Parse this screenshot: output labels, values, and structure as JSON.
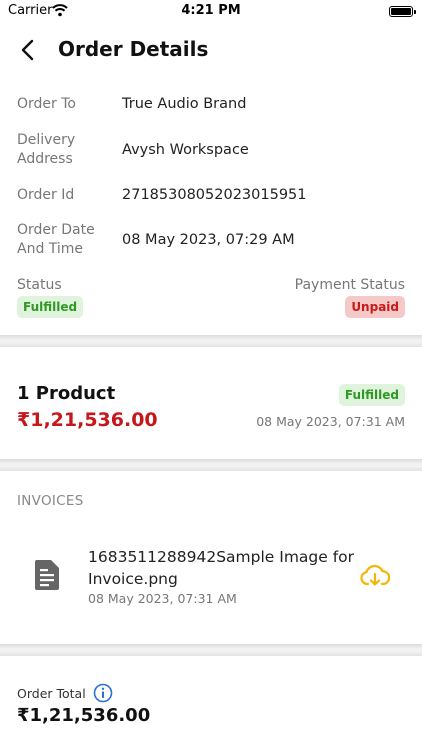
{
  "status_bar": {
    "carrier": "Carrier",
    "time": "4:21 PM"
  },
  "header": {
    "title": "Order Details",
    "back_icon": "chevron-left-icon"
  },
  "details": {
    "order_to_label": "Order To",
    "order_to_value": "True Audio Brand",
    "delivery_label": "Delivery Address",
    "delivery_value": "Avysh Workspace",
    "order_id_label": "Order Id",
    "order_id_value": "27185308052023015951",
    "order_date_label": "Order Date And Time",
    "order_date_value": "08 May 2023, 07:29 AM",
    "status_label": "Status",
    "status_value": "Fulfilled",
    "payment_status_label": "Payment Status",
    "payment_status_value": "Unpaid"
  },
  "product": {
    "count_label": "1 Product",
    "amount": "₹1,21,536.00",
    "status": "Fulfilled",
    "date": "08 May 2023, 07:31 AM"
  },
  "invoices": {
    "heading": "INVOICES",
    "items": [
      {
        "name": "1683511288942Sample Image for Invoice.png",
        "date": "08 May 2023, 07:31 AM",
        "file_icon": "file-document-icon",
        "download_icon": "cloud-download-icon"
      }
    ]
  },
  "footer": {
    "order_total_label": "Order Total",
    "order_total_value": "₹1,21,536.00",
    "info_icon": "info-icon"
  },
  "colors": {
    "accent_red": "#c8161d",
    "fulfilled_green": "#2f9a23",
    "fulfilled_bg": "#e0f3dc",
    "unpaid_red": "#c91a1a",
    "unpaid_bg": "#f6c9c9",
    "download_yellow": "#f2b705",
    "info_blue": "#2a6fd6"
  }
}
